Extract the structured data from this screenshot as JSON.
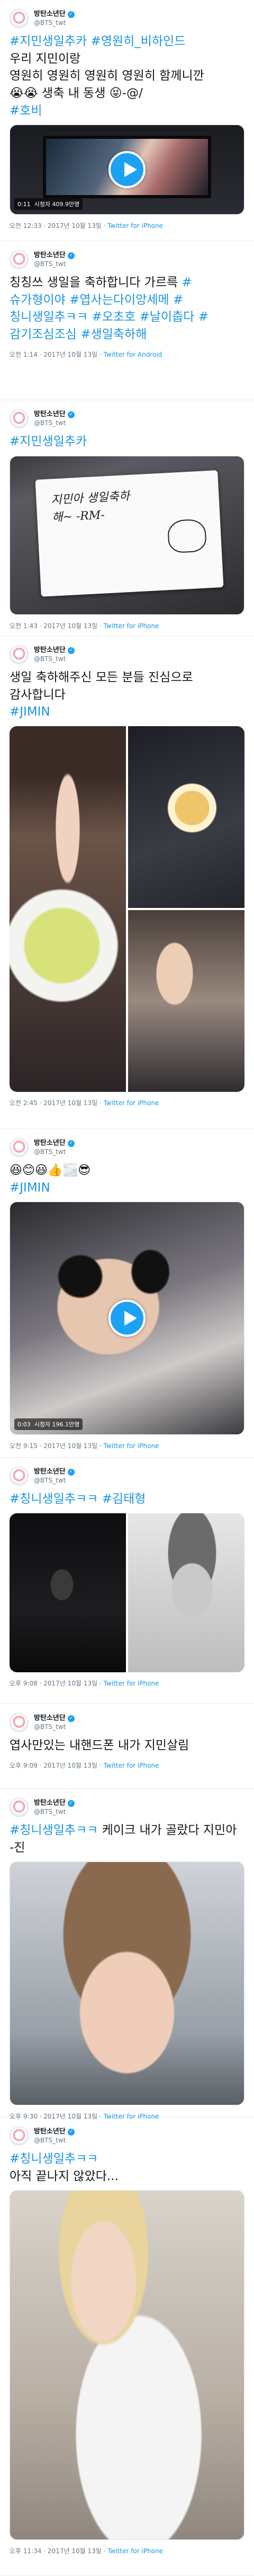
{
  "account": {
    "display_name": "방탄소년단",
    "handle": "@BTS_twt"
  },
  "tweets": [
    {
      "lines": [
        [
          {
            "t": "#지민생일추카",
            "tag": true
          },
          {
            "t": " "
          },
          {
            "t": "#영원히_비하인드",
            "tag": true
          }
        ],
        [
          {
            "t": "우리 지민이랑"
          }
        ],
        [
          {
            "t": "영원히 영원히 영원히 영원히 함께니깐"
          }
        ],
        [
          {
            "t": "😭😭 생축 내 동생 😝-@/"
          }
        ],
        [
          {
            "t": "#호비",
            "tag": true
          }
        ]
      ],
      "video_time": "0:11",
      "video_views": "시청자 409.9만명",
      "timestamp": "오전 12:33 · 2017년 10월 13일",
      "source": "Twitter for iPhone"
    },
    {
      "lines": [
        [
          {
            "t": "칭칭쓰 생일을 축하합니다 가르륵 "
          },
          {
            "t": "#슈가형이야",
            "tag": true
          },
          {
            "t": " "
          },
          {
            "t": "#엽사는다이앙세메",
            "tag": true
          },
          {
            "t": " "
          },
          {
            "t": "#칭니생일추ㅋㅋ",
            "tag": true
          },
          {
            "t": " "
          },
          {
            "t": "#오초호",
            "tag": true
          },
          {
            "t": " "
          },
          {
            "t": "#날이춥다",
            "tag": true
          },
          {
            "t": " "
          },
          {
            "t": "#감기조심조심",
            "tag": true
          },
          {
            "t": " "
          },
          {
            "t": "#생일축하해",
            "tag": true
          }
        ]
      ],
      "timestamp": "오전 1:14 · 2017년 10월 13일",
      "source": "Twitter for Android"
    },
    {
      "lines": [
        [
          {
            "t": "#지민생일추카",
            "tag": true
          }
        ]
      ],
      "image_text": "지민아 생일축하해~ -RM-",
      "timestamp": "오전 1:43 · 2017년 10월 13일",
      "source": "Twitter for iPhone"
    },
    {
      "lines": [
        [
          {
            "t": "생일 축하해주신 모든 분들 진심으로 감사합니다"
          }
        ],
        [
          {
            "t": "#JIMIN",
            "tag": true
          }
        ]
      ],
      "timestamp": "오전 2:45 · 2017년 10월 13일",
      "source": "Twitter for iPhone"
    },
    {
      "lines": [
        [
          {
            "t": "😆😊😃👍🌫️😎"
          }
        ],
        [
          {
            "t": "#JIMIN",
            "tag": true
          }
        ]
      ],
      "video_time": "0:03",
      "video_views": "시청자 196.1만명",
      "timestamp": "오전 9:15 · 2017년 10월 13일",
      "source": "Twitter for iPhone"
    },
    {
      "lines": [
        [
          {
            "t": "#칭니생일추ㅋㅋ",
            "tag": true
          },
          {
            "t": " "
          },
          {
            "t": "#김태형",
            "tag": true
          }
        ]
      ],
      "timestamp": "오후 9:08 · 2017년 10월 13일",
      "source": "Twitter for iPhone"
    },
    {
      "lines": [
        [
          {
            "t": "엽사만있는 내핸드폰 내가 지민살림"
          }
        ]
      ],
      "timestamp": "오후 9:09 · 2017년 10월 13일",
      "source": "Twitter for iPhone"
    },
    {
      "lines": [
        [
          {
            "t": "#칭니생일추ㅋㅋ",
            "tag": true
          },
          {
            "t": " 케이크 내가 골랐다 지민아 -진"
          }
        ]
      ],
      "timestamp": "오후 9:30 · 2017년 10월 13일",
      "source": "Twitter for iPhone"
    },
    {
      "lines": [
        [
          {
            "t": "#칭니생일추ㅋㅋ",
            "tag": true
          }
        ],
        [
          {
            "t": "아직 끝나지 않았다..."
          }
        ]
      ],
      "timestamp": "오후 11:34 · 2017년 10월 13일",
      "source": "Twitter for iPhone"
    }
  ],
  "colors": {
    "link": "#1b95e0",
    "verified": "#1da1f2",
    "meta": "#657786"
  }
}
